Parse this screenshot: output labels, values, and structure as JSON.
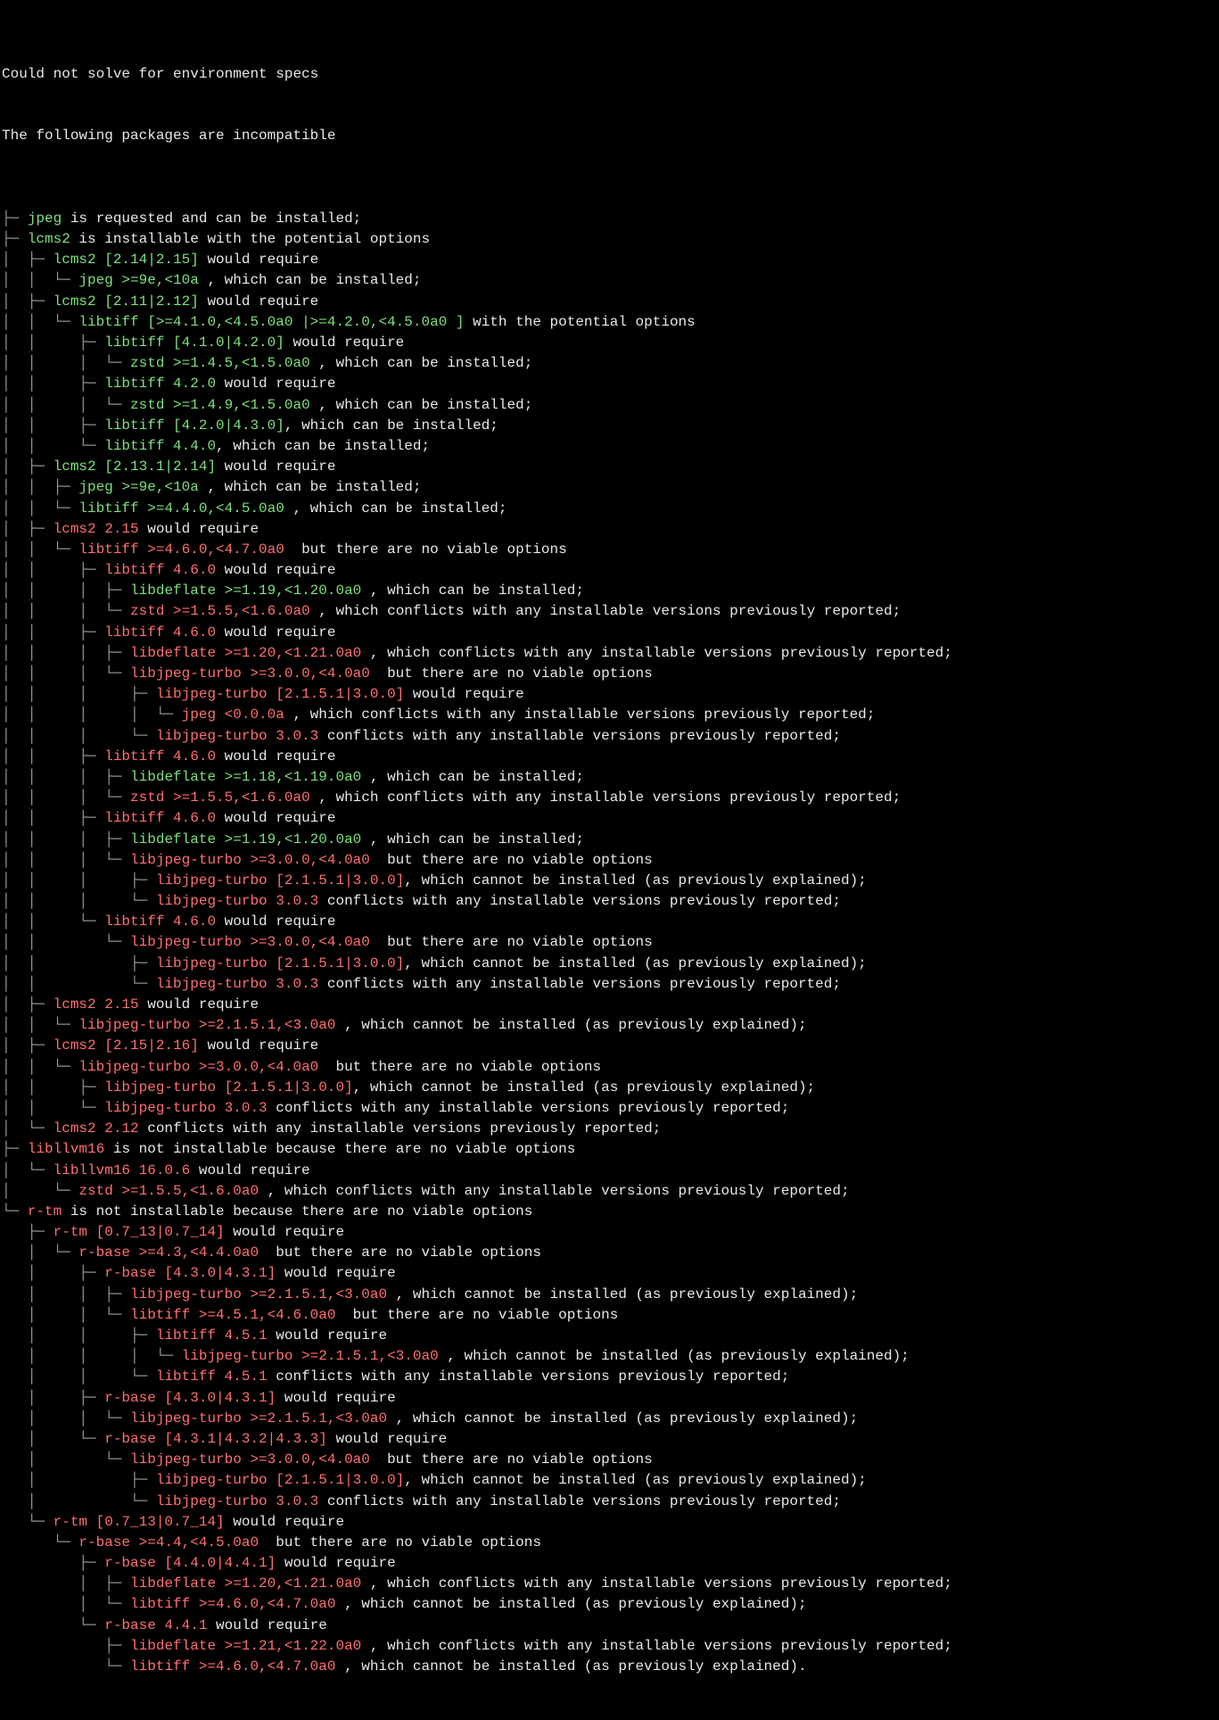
{
  "header": [
    "Could not solve for environment specs",
    "The following packages are incompatible"
  ],
  "phrases": {
    "requested_install": " is requested and can be installed;",
    "installable_opts": " is installable with the potential options",
    "would_require": " would require",
    "can_install": " , which can be installed;",
    "can_install_nosemi": ", which can be installed;",
    "with_opts": " with the potential options",
    "no_viable": "  but there are no viable options",
    "conflicts_prev": " , which conflicts with any installable versions previously reported;",
    "conflicts_prev_end": " conflicts with any installable versions previously reported;",
    "cannot_install_expl": ", which cannot be installed (as previously explained);",
    "cannot_install_space": " , which cannot be installed (as previously explained);",
    "cannot_install_dot": " , which cannot be installed (as previously explained).",
    "not_installable": " is not installable because there are no viable options"
  },
  "lines": [
    {
      "indent": "├─ ",
      "pkg": "jpeg",
      "pcolor": "ok",
      "tail": "requested_install"
    },
    {
      "indent": "├─ ",
      "pkg": "lcms2",
      "pcolor": "ok",
      "tail": "installable_opts"
    },
    {
      "indent": "│  ├─ ",
      "pkg": "lcms2 [2.14|2.15]",
      "pcolor": "ok",
      "tail": "would_require"
    },
    {
      "indent": "│  │  └─ ",
      "pkg": "jpeg >=9e,<10a",
      "pcolor": "ok",
      "tail": "can_install"
    },
    {
      "indent": "│  ├─ ",
      "pkg": "lcms2 [2.11|2.12]",
      "pcolor": "ok",
      "tail": "would_require"
    },
    {
      "indent": "│  │  └─ ",
      "pkg": "libtiff [>=4.1.0,<4.5.0a0 |>=4.2.0,<4.5.0a0 ]",
      "pcolor": "ok",
      "tail": "with_opts"
    },
    {
      "indent": "│  │     ├─ ",
      "pkg": "libtiff [4.1.0|4.2.0]",
      "pcolor": "ok",
      "tail": "would_require"
    },
    {
      "indent": "│  │     │  └─ ",
      "pkg": "zstd >=1.4.5,<1.5.0a0",
      "pcolor": "ok",
      "tail": "can_install"
    },
    {
      "indent": "│  │     ├─ ",
      "pkg": "libtiff 4.2.0",
      "pcolor": "ok",
      "tail": "would_require"
    },
    {
      "indent": "│  │     │  └─ ",
      "pkg": "zstd >=1.4.9,<1.5.0a0",
      "pcolor": "ok",
      "tail": "can_install"
    },
    {
      "indent": "│  │     ├─ ",
      "pkg": "libtiff [4.2.0|4.3.0]",
      "pcolor": "ok",
      "tail": "can_install_nosemi"
    },
    {
      "indent": "│  │     └─ ",
      "pkg": "libtiff 4.4.0",
      "pcolor": "ok",
      "tail": "can_install_nosemi"
    },
    {
      "indent": "│  ├─ ",
      "pkg": "lcms2 [2.13.1|2.14]",
      "pcolor": "ok",
      "tail": "would_require"
    },
    {
      "indent": "│  │  ├─ ",
      "pkg": "jpeg >=9e,<10a",
      "pcolor": "ok",
      "tail": "can_install"
    },
    {
      "indent": "│  │  └─ ",
      "pkg": "libtiff >=4.4.0,<4.5.0a0",
      "pcolor": "ok",
      "tail": "can_install"
    },
    {
      "indent": "│  ├─ ",
      "pkg": "lcms2 2.15",
      "pcolor": "bad",
      "tail": "would_require"
    },
    {
      "indent": "│  │  └─ ",
      "pkg": "libtiff >=4.6.0,<4.7.0a0",
      "pcolor": "bad",
      "tail": "no_viable"
    },
    {
      "indent": "│  │     ├─ ",
      "pkg": "libtiff 4.6.0",
      "pcolor": "bad",
      "tail": "would_require"
    },
    {
      "indent": "│  │     │  ├─ ",
      "pkg": "libdeflate >=1.19,<1.20.0a0",
      "pcolor": "ok",
      "tail": "can_install"
    },
    {
      "indent": "│  │     │  └─ ",
      "pkg": "zstd >=1.5.5,<1.6.0a0",
      "pcolor": "bad",
      "tail": "conflicts_prev"
    },
    {
      "indent": "│  │     ├─ ",
      "pkg": "libtiff 4.6.0",
      "pcolor": "bad",
      "tail": "would_require"
    },
    {
      "indent": "│  │     │  ├─ ",
      "pkg": "libdeflate >=1.20,<1.21.0a0",
      "pcolor": "bad",
      "tail": "conflicts_prev"
    },
    {
      "indent": "│  │     │  └─ ",
      "pkg": "libjpeg-turbo >=3.0.0,<4.0a0",
      "pcolor": "bad",
      "tail": "no_viable"
    },
    {
      "indent": "│  │     │     ├─ ",
      "pkg": "libjpeg-turbo [2.1.5.1|3.0.0]",
      "pcolor": "bad",
      "tail": "would_require"
    },
    {
      "indent": "│  │     │     │  └─ ",
      "pkg": "jpeg <0.0.0a",
      "pcolor": "bad",
      "tail": "conflicts_prev"
    },
    {
      "indent": "│  │     │     └─ ",
      "pkg": "libjpeg-turbo 3.0.3",
      "pcolor": "bad",
      "tail": "conflicts_prev_end"
    },
    {
      "indent": "│  │     ├─ ",
      "pkg": "libtiff 4.6.0",
      "pcolor": "bad",
      "tail": "would_require"
    },
    {
      "indent": "│  │     │  ├─ ",
      "pkg": "libdeflate >=1.18,<1.19.0a0",
      "pcolor": "ok",
      "tail": "can_install"
    },
    {
      "indent": "│  │     │  └─ ",
      "pkg": "zstd >=1.5.5,<1.6.0a0",
      "pcolor": "bad",
      "tail": "conflicts_prev"
    },
    {
      "indent": "│  │     ├─ ",
      "pkg": "libtiff 4.6.0",
      "pcolor": "bad",
      "tail": "would_require"
    },
    {
      "indent": "│  │     │  ├─ ",
      "pkg": "libdeflate >=1.19,<1.20.0a0",
      "pcolor": "ok",
      "tail": "can_install"
    },
    {
      "indent": "│  │     │  └─ ",
      "pkg": "libjpeg-turbo >=3.0.0,<4.0a0",
      "pcolor": "bad",
      "tail": "no_viable"
    },
    {
      "indent": "│  │     │     ├─ ",
      "pkg": "libjpeg-turbo [2.1.5.1|3.0.0]",
      "pcolor": "bad",
      "tail": "cannot_install_expl"
    },
    {
      "indent": "│  │     │     └─ ",
      "pkg": "libjpeg-turbo 3.0.3",
      "pcolor": "bad",
      "tail": "conflicts_prev_end"
    },
    {
      "indent": "│  │     └─ ",
      "pkg": "libtiff 4.6.0",
      "pcolor": "bad",
      "tail": "would_require"
    },
    {
      "indent": "│  │        └─ ",
      "pkg": "libjpeg-turbo >=3.0.0,<4.0a0",
      "pcolor": "bad",
      "tail": "no_viable"
    },
    {
      "indent": "│  │           ├─ ",
      "pkg": "libjpeg-turbo [2.1.5.1|3.0.0]",
      "pcolor": "bad",
      "tail": "cannot_install_expl"
    },
    {
      "indent": "│  │           └─ ",
      "pkg": "libjpeg-turbo 3.0.3",
      "pcolor": "bad",
      "tail": "conflicts_prev_end"
    },
    {
      "indent": "│  ├─ ",
      "pkg": "lcms2 2.15",
      "pcolor": "bad",
      "tail": "would_require"
    },
    {
      "indent": "│  │  └─ ",
      "pkg": "libjpeg-turbo >=2.1.5.1,<3.0a0",
      "pcolor": "bad",
      "tail": "cannot_install_space"
    },
    {
      "indent": "│  ├─ ",
      "pkg": "lcms2 [2.15|2.16]",
      "pcolor": "bad",
      "tail": "would_require"
    },
    {
      "indent": "│  │  └─ ",
      "pkg": "libjpeg-turbo >=3.0.0,<4.0a0",
      "pcolor": "bad",
      "tail": "no_viable"
    },
    {
      "indent": "│  │     ├─ ",
      "pkg": "libjpeg-turbo [2.1.5.1|3.0.0]",
      "pcolor": "bad",
      "tail": "cannot_install_expl"
    },
    {
      "indent": "│  │     └─ ",
      "pkg": "libjpeg-turbo 3.0.3",
      "pcolor": "bad",
      "tail": "conflicts_prev_end"
    },
    {
      "indent": "│  └─ ",
      "pkg": "lcms2 2.12",
      "pcolor": "bad",
      "tail": "conflicts_prev_end"
    },
    {
      "indent": "├─ ",
      "pkg": "libllvm16",
      "pcolor": "bad",
      "tail": "not_installable"
    },
    {
      "indent": "│  └─ ",
      "pkg": "libllvm16 16.0.6",
      "pcolor": "bad",
      "tail": "would_require"
    },
    {
      "indent": "│     └─ ",
      "pkg": "zstd >=1.5.5,<1.6.0a0",
      "pcolor": "bad",
      "tail": "conflicts_prev"
    },
    {
      "indent": "└─ ",
      "pkg": "r-tm",
      "pcolor": "bad",
      "tail": "not_installable"
    },
    {
      "indent": "   ├─ ",
      "pkg": "r-tm [0.7_13|0.7_14]",
      "pcolor": "bad",
      "tail": "would_require"
    },
    {
      "indent": "   │  └─ ",
      "pkg": "r-base >=4.3,<4.4.0a0",
      "pcolor": "bad",
      "tail": "no_viable"
    },
    {
      "indent": "   │     ├─ ",
      "pkg": "r-base [4.3.0|4.3.1]",
      "pcolor": "bad",
      "tail": "would_require"
    },
    {
      "indent": "   │     │  ├─ ",
      "pkg": "libjpeg-turbo >=2.1.5.1,<3.0a0",
      "pcolor": "bad",
      "tail": "cannot_install_space"
    },
    {
      "indent": "   │     │  └─ ",
      "pkg": "libtiff >=4.5.1,<4.6.0a0",
      "pcolor": "bad",
      "tail": "no_viable"
    },
    {
      "indent": "   │     │     ├─ ",
      "pkg": "libtiff 4.5.1",
      "pcolor": "bad",
      "tail": "would_require"
    },
    {
      "indent": "   │     │     │  └─ ",
      "pkg": "libjpeg-turbo >=2.1.5.1,<3.0a0",
      "pcolor": "bad",
      "tail": "cannot_install_space"
    },
    {
      "indent": "   │     │     └─ ",
      "pkg": "libtiff 4.5.1",
      "pcolor": "bad",
      "tail": "conflicts_prev_end"
    },
    {
      "indent": "   │     ├─ ",
      "pkg": "r-base [4.3.0|4.3.1]",
      "pcolor": "bad",
      "tail": "would_require"
    },
    {
      "indent": "   │     │  └─ ",
      "pkg": "libjpeg-turbo >=2.1.5.1,<3.0a0",
      "pcolor": "bad",
      "tail": "cannot_install_space"
    },
    {
      "indent": "   │     └─ ",
      "pkg": "r-base [4.3.1|4.3.2|4.3.3]",
      "pcolor": "bad",
      "tail": "would_require"
    },
    {
      "indent": "   │        └─ ",
      "pkg": "libjpeg-turbo >=3.0.0,<4.0a0",
      "pcolor": "bad",
      "tail": "no_viable"
    },
    {
      "indent": "   │           ├─ ",
      "pkg": "libjpeg-turbo [2.1.5.1|3.0.0]",
      "pcolor": "bad",
      "tail": "cannot_install_expl"
    },
    {
      "indent": "   │           └─ ",
      "pkg": "libjpeg-turbo 3.0.3",
      "pcolor": "bad",
      "tail": "conflicts_prev_end"
    },
    {
      "indent": "   └─ ",
      "pkg": "r-tm [0.7_13|0.7_14]",
      "pcolor": "bad",
      "tail": "would_require"
    },
    {
      "indent": "      └─ ",
      "pkg": "r-base >=4.4,<4.5.0a0",
      "pcolor": "bad",
      "tail": "no_viable"
    },
    {
      "indent": "         ├─ ",
      "pkg": "r-base [4.4.0|4.4.1]",
      "pcolor": "bad",
      "tail": "would_require"
    },
    {
      "indent": "         │  ├─ ",
      "pkg": "libdeflate >=1.20,<1.21.0a0",
      "pcolor": "bad",
      "tail": "conflicts_prev"
    },
    {
      "indent": "         │  └─ ",
      "pkg": "libtiff >=4.6.0,<4.7.0a0",
      "pcolor": "bad",
      "tail": "cannot_install_space"
    },
    {
      "indent": "         └─ ",
      "pkg": "r-base 4.4.1",
      "pcolor": "bad",
      "tail": "would_require"
    },
    {
      "indent": "            ├─ ",
      "pkg": "libdeflate >=1.21,<1.22.0a0",
      "pcolor": "bad",
      "tail": "conflicts_prev"
    },
    {
      "indent": "            └─ ",
      "pkg": "libtiff >=4.6.0,<4.7.0a0",
      "pcolor": "bad",
      "tail": "cannot_install_dot"
    }
  ]
}
